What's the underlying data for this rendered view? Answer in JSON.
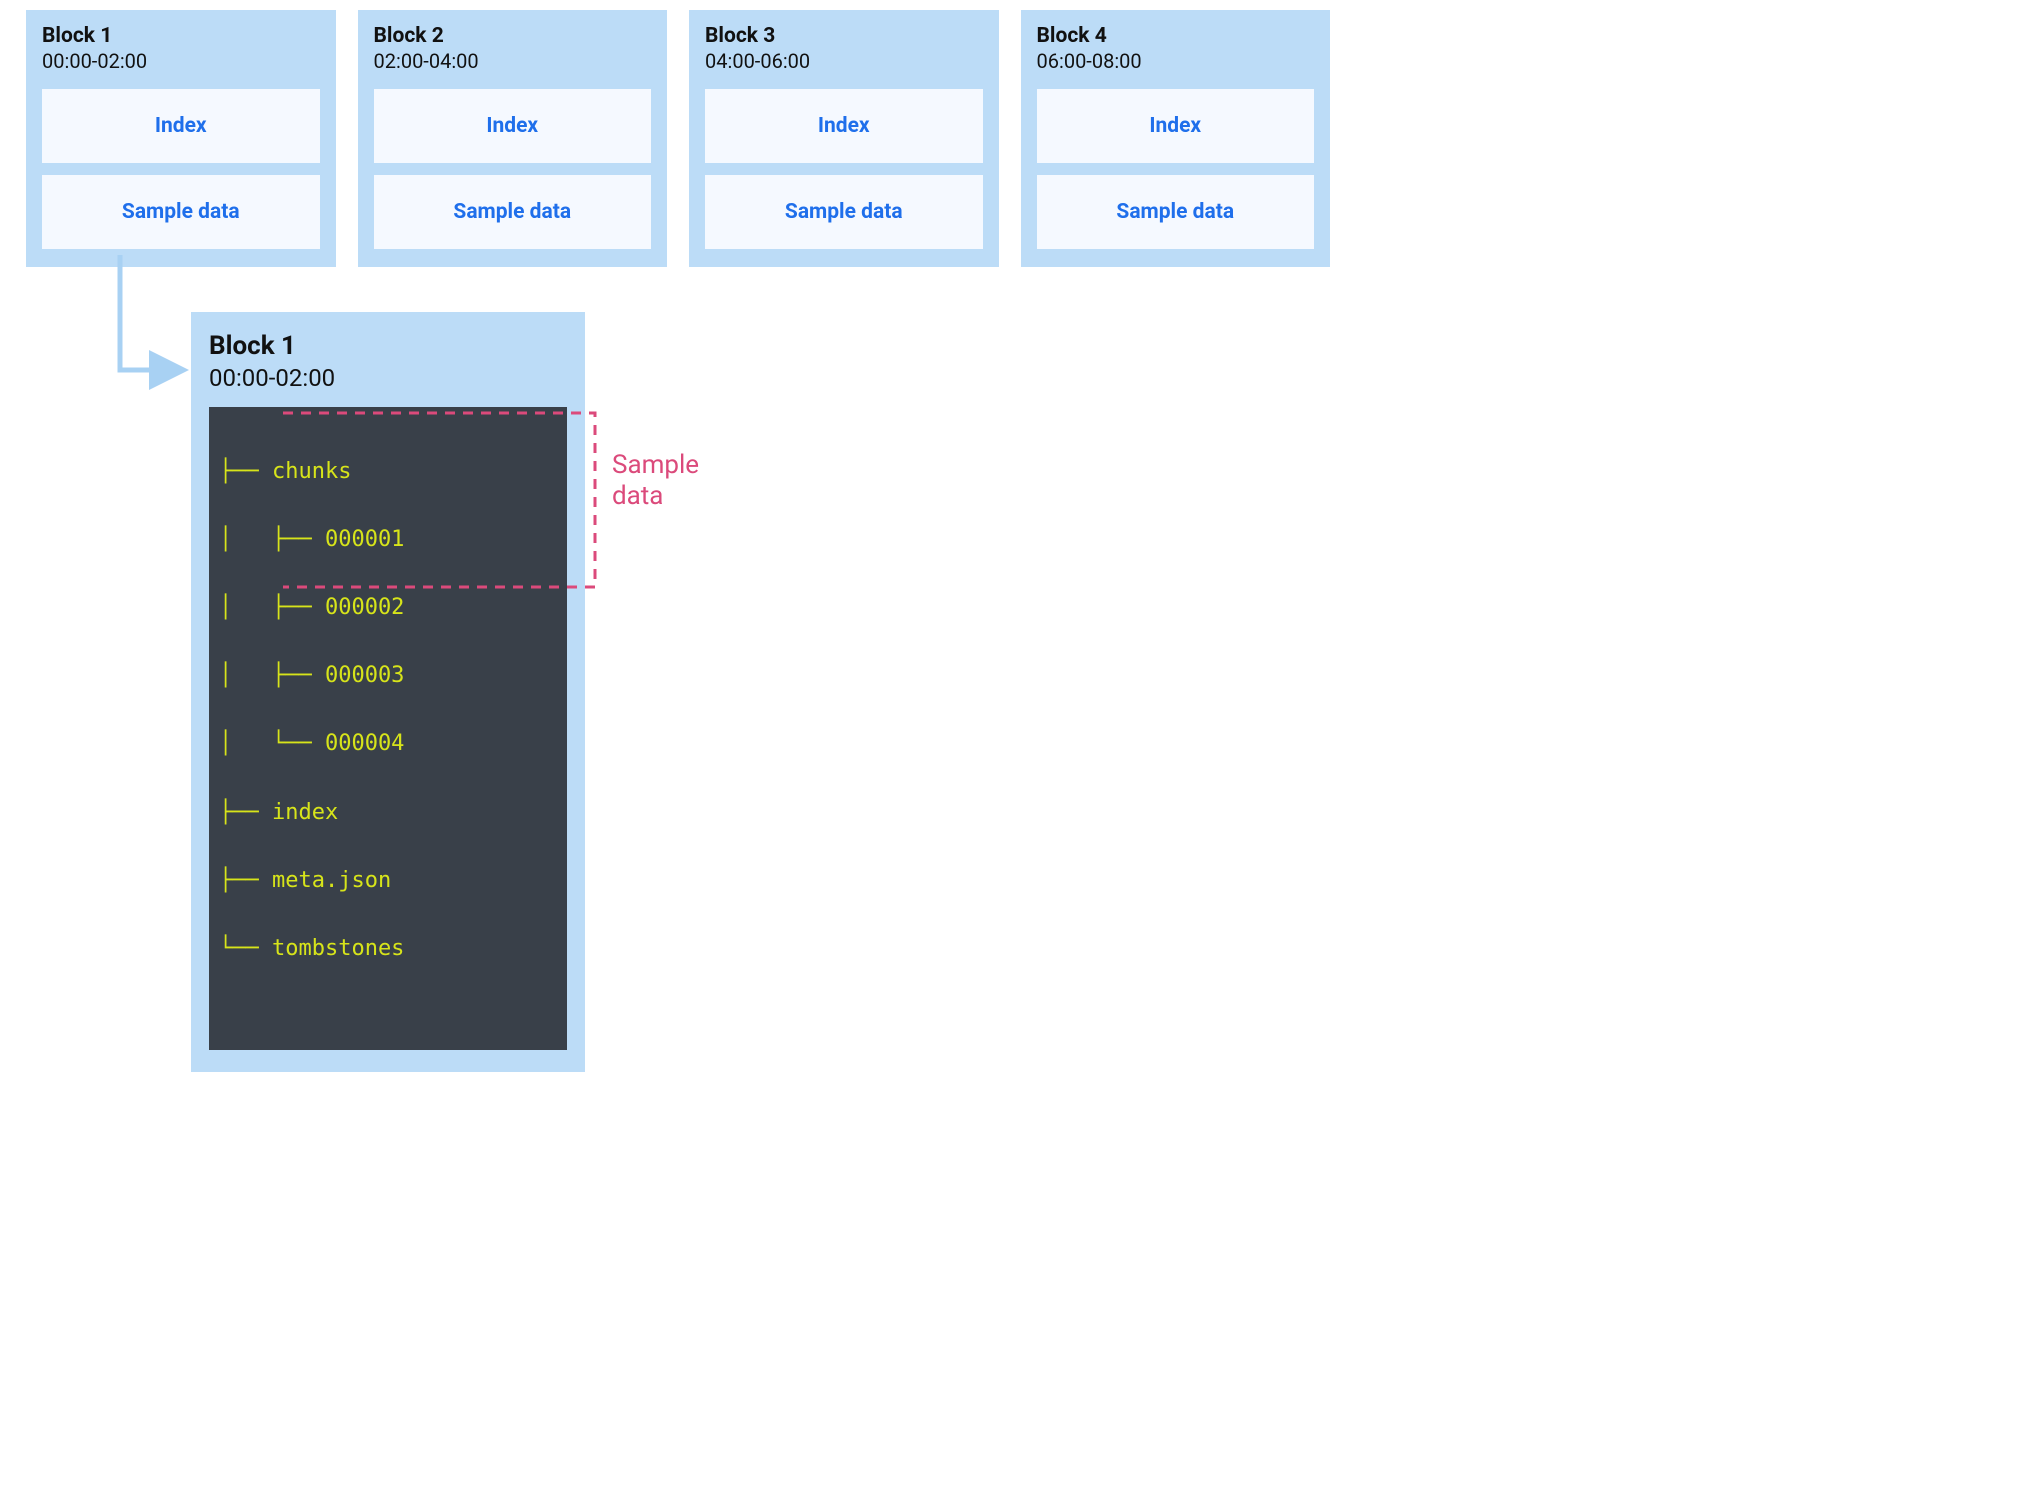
{
  "blocks": [
    {
      "title": "Block 1",
      "range": "00:00-02:00",
      "index_label": "Index",
      "sample_label": "Sample data"
    },
    {
      "title": "Block 2",
      "range": "02:00-04:00",
      "index_label": "Index",
      "sample_label": "Sample data"
    },
    {
      "title": "Block 3",
      "range": "04:00-06:00",
      "index_label": "Index",
      "sample_label": "Sample data"
    },
    {
      "title": "Block 4",
      "range": "06:00-08:00",
      "index_label": "Index",
      "sample_label": "Sample data"
    }
  ],
  "detail": {
    "title": "Block 1",
    "range": "00:00-02:00",
    "tree_lines": [
      "├── chunks",
      "│   ├── 000001",
      "│   ├── 000002",
      "│   ├── 000003",
      "│   └── 000004",
      "├── index",
      "├── meta.json",
      "└── tombstones"
    ]
  },
  "annotation": {
    "label_line1": "Sample",
    "label_line2": "data"
  }
}
